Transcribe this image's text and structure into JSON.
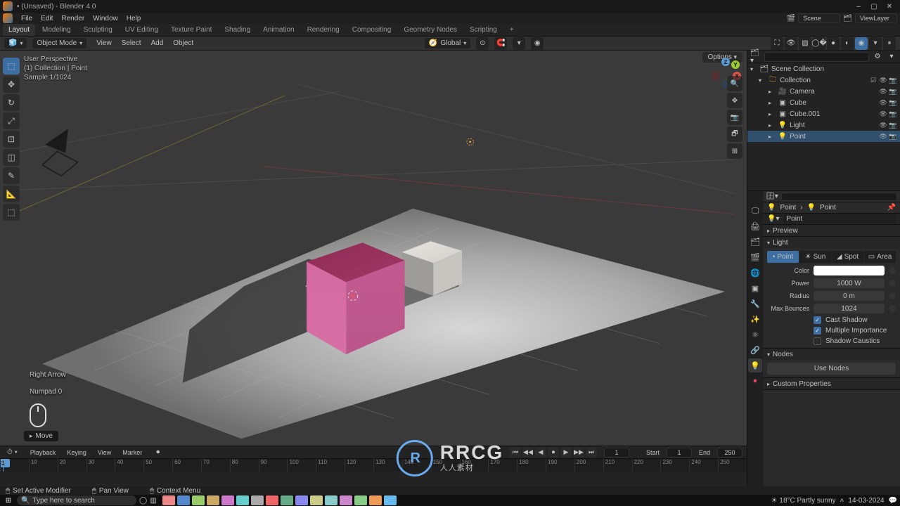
{
  "title": "• (Unsaved) - Blender 4.0",
  "window_controls": {
    "min": "–",
    "max": "▢",
    "close": "✕"
  },
  "top_menu": [
    "File",
    "Edit",
    "Render",
    "Window",
    "Help"
  ],
  "scene_field": "Scene",
  "viewlayer_field": "ViewLayer",
  "workspace_tabs": [
    "Layout",
    "Modeling",
    "Sculpting",
    "UV Editing",
    "Texture Paint",
    "Shading",
    "Animation",
    "Rendering",
    "Compositing",
    "Geometry Nodes",
    "Scripting",
    "+"
  ],
  "active_ws_index": 0,
  "toolbar": {
    "mode": "Object Mode",
    "menus": [
      "View",
      "Select",
      "Add",
      "Object"
    ],
    "orientation": "Global"
  },
  "viewport": {
    "overlay_lines": [
      "User Perspective",
      "(1) Collection | Point",
      "Sample 1/1024"
    ],
    "options_label": "Options",
    "keys": [
      "Right Arrow",
      "Numpad 0"
    ],
    "undo_toast": "Move",
    "axis_labels": {
      "x": "X",
      "y": "Y",
      "z": "Z"
    },
    "render_stats": {
      "samples": "Sample 1/1024"
    }
  },
  "left_tool_icons": [
    "⬚",
    "✥",
    "↻",
    "⤢",
    "⊡",
    "◫",
    "✎",
    "📐",
    "⬚"
  ],
  "right_vp_icons": [
    "🔍",
    "✥",
    "📷",
    "🗗",
    "⊞"
  ],
  "timeline": {
    "menus": [
      "Playback",
      "Keying",
      "View",
      "Marker"
    ],
    "transport_icons": [
      "⏮",
      "◀◀",
      "◀",
      "⏺",
      "▶",
      "▶▶",
      "⏭"
    ],
    "current_frame": "1",
    "start_label": "Start",
    "start": "1",
    "end_label": "End",
    "end": "250",
    "ticks": [
      0,
      10,
      20,
      30,
      40,
      50,
      60,
      70,
      80,
      90,
      100,
      110,
      120,
      130,
      140,
      150,
      160,
      170,
      180,
      190,
      200,
      210,
      220,
      230,
      240,
      250
    ]
  },
  "statusbar": {
    "items": [
      "Set Active Modifier",
      "Pan View",
      "Context Menu"
    ]
  },
  "outliner": {
    "root": "Scene Collection",
    "collection": "Collection",
    "items": [
      {
        "name": "Camera",
        "icon": "🎥",
        "selected": false
      },
      {
        "name": "Cube",
        "icon": "▣",
        "selected": false
      },
      {
        "name": "Cube.001",
        "icon": "▣",
        "selected": false
      },
      {
        "name": "Light",
        "icon": "💡",
        "selected": false
      },
      {
        "name": "Point",
        "icon": "💡",
        "selected": true
      }
    ]
  },
  "properties": {
    "breadcrumb": [
      "Point",
      "Point"
    ],
    "datablock_header": "Point",
    "sections": {
      "preview": "Preview",
      "light": "Light",
      "nodes": "Nodes",
      "custom": "Custom Properties"
    },
    "light_types": [
      "Point",
      "Sun",
      "Spot",
      "Area"
    ],
    "active_light_type": 0,
    "rows": {
      "color_label": "Color",
      "power_label": "Power",
      "power_value": "1000 W",
      "radius_label": "Radius",
      "radius_value": "0 m",
      "max_bounces_label": "Max Bounces",
      "max_bounces_value": "1024",
      "cast_shadow_label": "Cast Shadow",
      "cast_shadow": true,
      "multi_importance_label": "Multiple Importance",
      "multi_importance": true,
      "shadow_caustics_label": "Shadow Caustics",
      "shadow_caustics": false,
      "use_nodes_btn": "Use Nodes"
    },
    "color_hex": "#ffffff"
  },
  "watermark": {
    "logo": "R",
    "title": "RRCG",
    "sub": "人人素材"
  },
  "taskbar": {
    "search_placeholder": "Type here to search",
    "weather": "18°C Partly sunny",
    "time": "14-03-2024",
    "task_count": 16
  }
}
